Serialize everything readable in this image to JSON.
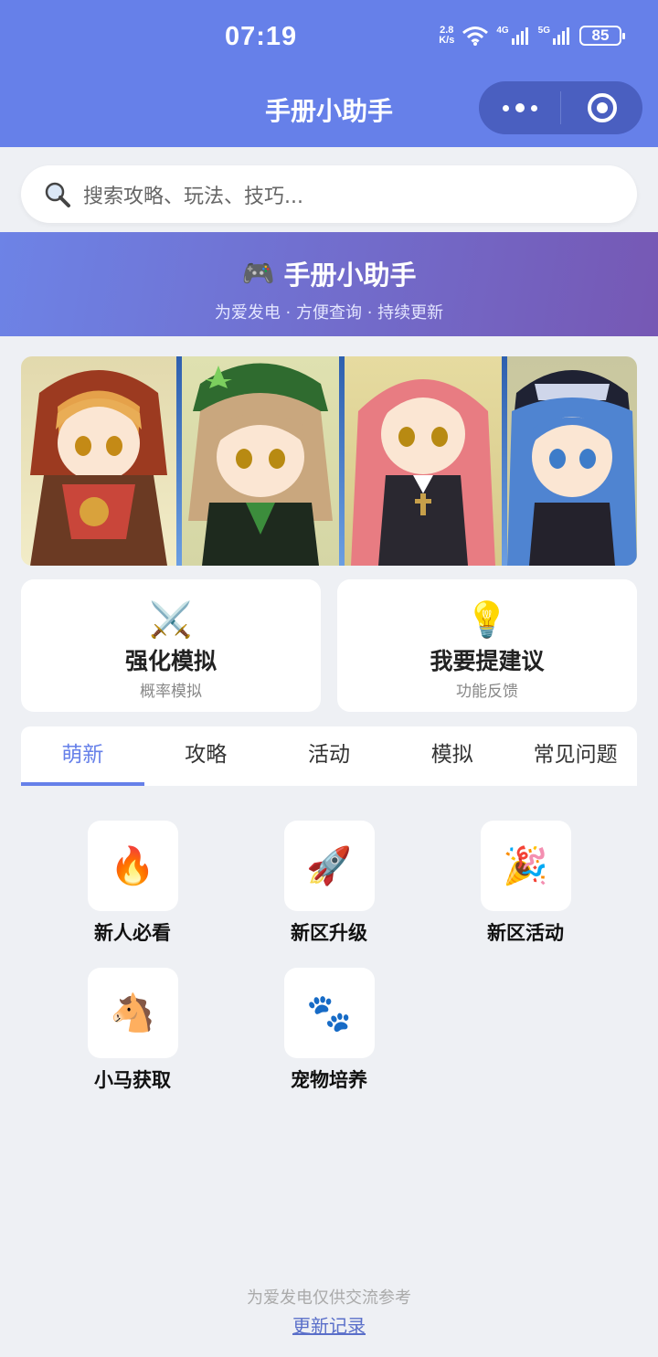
{
  "status_bar": {
    "time": "07:19",
    "net_speed_value": "2.8",
    "net_speed_unit": "K/s",
    "sig1": "4G",
    "sig2": "5G",
    "battery": "85"
  },
  "nav": {
    "title": "手册小助手"
  },
  "search": {
    "placeholder": "搜索攻略、玩法、技巧..."
  },
  "banner": {
    "emoji": "🎮",
    "title": "手册小助手",
    "subtitle": "为爱发电 · 方便查询 · 持续更新"
  },
  "cards": [
    {
      "emoji": "⚔️",
      "title": "强化模拟",
      "subtitle": "概率模拟"
    },
    {
      "emoji": "💡",
      "title": "我要提建议",
      "subtitle": "功能反馈"
    }
  ],
  "tabs": [
    "萌新",
    "攻略",
    "活动",
    "模拟",
    "常见问题"
  ],
  "active_tab": "萌新",
  "grid": [
    {
      "emoji": "🔥",
      "label": "新人必看"
    },
    {
      "emoji": "🚀",
      "label": "新区升级"
    },
    {
      "emoji": "🎉",
      "label": "新区活动"
    },
    {
      "emoji": "🐴",
      "label": "小马获取"
    },
    {
      "emoji": "🐾",
      "label": "宠物培养"
    }
  ],
  "footer": {
    "note": "为爱发电仅供交流参考",
    "link": "更新记录"
  },
  "colors": {
    "primary": "#6680e9",
    "banner_end": "#7658b4",
    "background": "#eef0f4"
  }
}
